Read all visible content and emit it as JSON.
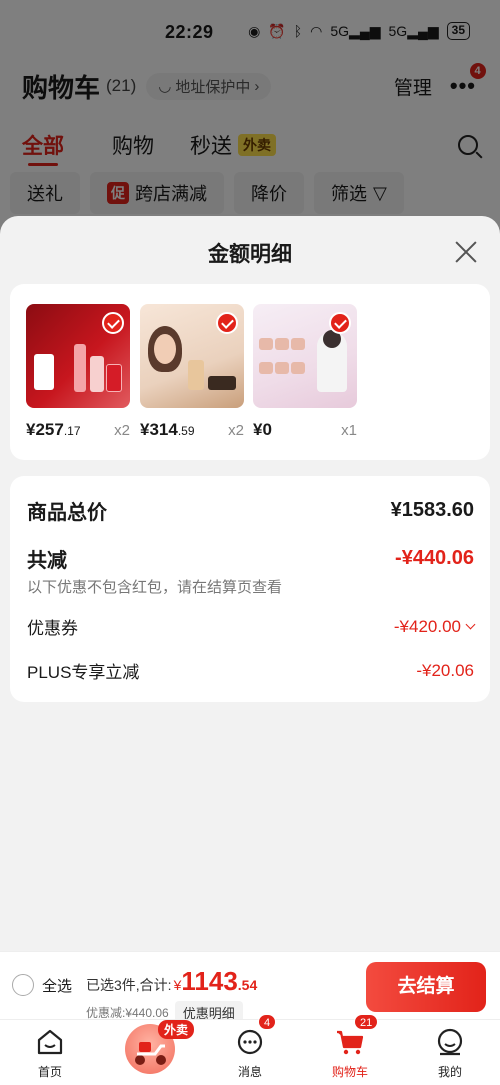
{
  "status": {
    "time": "22:29",
    "battery": "35",
    "net1": "5G",
    "net2": "5G"
  },
  "header": {
    "title": "购物车",
    "count": "(21)",
    "address_protect": "地址保护中",
    "manage": "管理",
    "more_badge": "4"
  },
  "tabs": {
    "all": "全部",
    "shopping": "购物",
    "flash": "秒送",
    "flash_tag": "外卖"
  },
  "filters": {
    "gift": "送礼",
    "cu_tag": "促",
    "cross_shop": "跨店满减",
    "price_drop": "降价",
    "filter": "筛选"
  },
  "sheet": {
    "title": "金额明细",
    "products": [
      {
        "price_int": "¥257",
        "price_dec": ".17",
        "qty": "x2"
      },
      {
        "price_int": "¥314",
        "price_dec": ".59",
        "qty": "x2"
      },
      {
        "price_int": "¥0",
        "price_dec": "",
        "qty": "x1"
      }
    ],
    "detail": {
      "total_label": "商品总价",
      "total_value": "¥1583.60",
      "discount_label": "共减",
      "discount_value": "-¥440.06",
      "discount_note": "以下优惠不包含红包，请在结算页查看",
      "coupon_label": "优惠券",
      "coupon_value": "-¥420.00",
      "plus_label": "PLUS专享立减",
      "plus_value": "-¥20.06"
    }
  },
  "checkout": {
    "select_all": "全选",
    "selected_text": "已选3件,合计:",
    "currency": "¥",
    "total_int": "1143",
    "total_dec": ".54",
    "discount_text": "优惠减:¥440.06",
    "detail_btn": "优惠明细",
    "checkout_btn": "去结算"
  },
  "tabbar": {
    "home": "首页",
    "waimai": "外卖",
    "messages": "消息",
    "messages_badge": "4",
    "cart": "购物车",
    "cart_badge": "21",
    "mine": "我的"
  },
  "colors": {
    "accent": "#e2231a",
    "waimai_tag": "#ffe14d"
  }
}
